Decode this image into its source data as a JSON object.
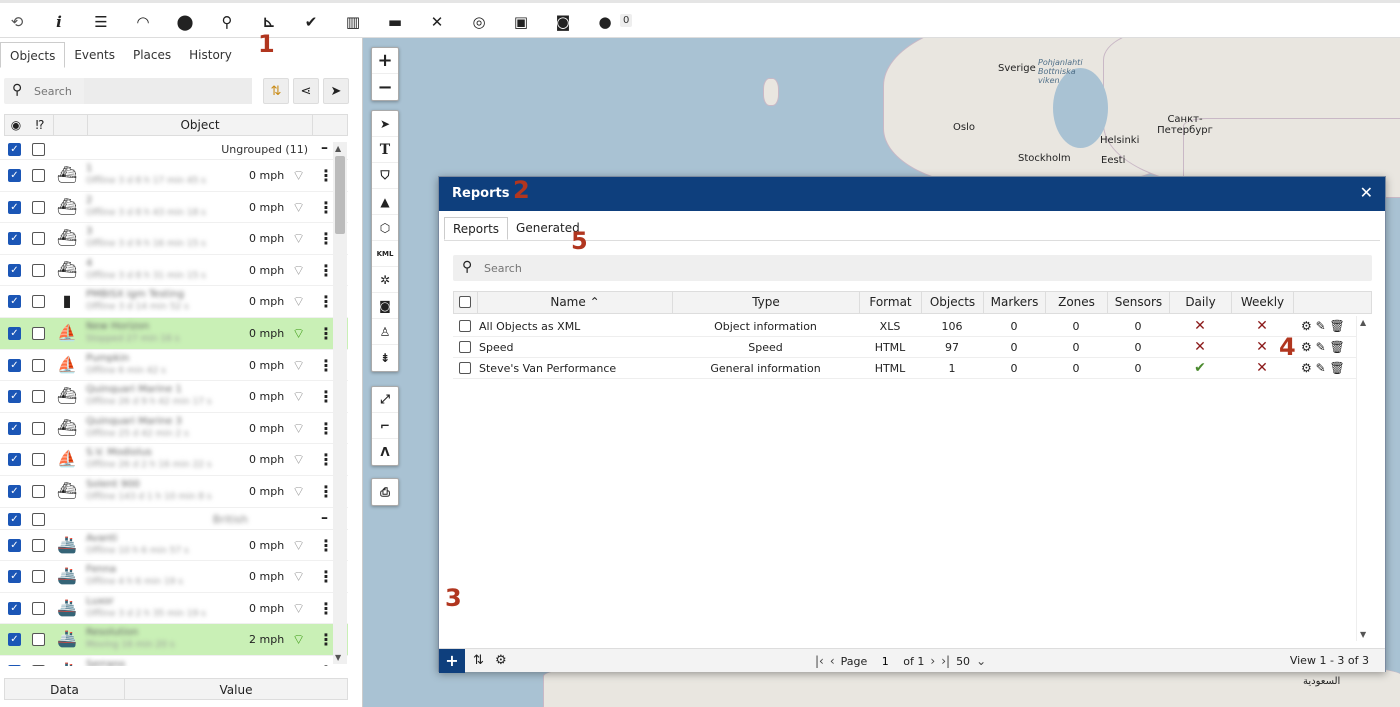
{
  "toolbar": {
    "icons": [
      "logo-icon",
      "info-icon",
      "sliders-icon",
      "speedometer-icon",
      "marker-icon",
      "search-icon",
      "chart-icon",
      "check-icon",
      "book-icon",
      "car-icon",
      "tools-icon",
      "database-icon",
      "code-window-icon",
      "camera-icon",
      "chat-icon"
    ],
    "chat_count": "0"
  },
  "annotations": [
    "1",
    "2",
    "3",
    "4",
    "5"
  ],
  "left": {
    "tabs": [
      "Objects",
      "Events",
      "Places",
      "History"
    ],
    "search_placeholder": "Search",
    "object_col": "Object",
    "group1_label": "Ungrouped (11)",
    "group2_label": "British",
    "minus": "–",
    "data_col": "Data",
    "value_col": "Value",
    "rows": [
      {
        "name": "1",
        "sub": "Offline 3 d 8 h 17 min 45 s",
        "speed": "0 mph",
        "green": false,
        "vehicle": "boat-icon"
      },
      {
        "name": "2",
        "sub": "Offline 3 d 8 h 43 min 18 s",
        "speed": "0 mph",
        "green": false,
        "vehicle": "boat-icon"
      },
      {
        "name": "3",
        "sub": "Offline 3 d 9 h 16 min 15 s",
        "speed": "0 mph",
        "green": false,
        "vehicle": "boat-icon"
      },
      {
        "name": "4",
        "sub": "Offline 3 d 8 h 31 min 15 s",
        "speed": "0 mph",
        "green": false,
        "vehicle": "boat-icon"
      },
      {
        "name": "PMBISX igm Testing",
        "sub": "Offline 3 d 14 min 52 s",
        "speed": "0 mph",
        "green": false,
        "vehicle": "device-icon"
      },
      {
        "name": "New Horizon",
        "sub": "Stopped 27 min 16 s",
        "speed": "0 mph",
        "green": true,
        "vehicle": "rib-icon"
      },
      {
        "name": "Pumpkin",
        "sub": "Offline 6 min 42 s",
        "speed": "0 mph",
        "green": false,
        "vehicle": "rib-icon"
      },
      {
        "name": "Quinquari Marine 1",
        "sub": "Offline 26 d 9 h 42 min 17 s",
        "speed": "0 mph",
        "green": false,
        "vehicle": "boat-icon"
      },
      {
        "name": "Quinquari Marine 3",
        "sub": "Offline 25 d 42 min 2 s",
        "speed": "0 mph",
        "green": false,
        "vehicle": "boat-icon"
      },
      {
        "name": "S.V. Modiolus",
        "sub": "Offline 26 d 2 h 16 min 22 s",
        "speed": "0 mph",
        "green": false,
        "vehicle": "rib-icon"
      },
      {
        "name": "Solent 900",
        "sub": "Offline 143 d 1 h 10 min 8 s",
        "speed": "0 mph",
        "green": false,
        "vehicle": "boat-icon"
      },
      {
        "group": true
      },
      {
        "name": "Avanti",
        "sub": "Offline 10 h 6 min 57 s",
        "speed": "0 mph",
        "green": false,
        "vehicle": "ship-icon"
      },
      {
        "name": "Fenna",
        "sub": "Offline 4 h 6 min 19 s",
        "speed": "0 mph",
        "green": false,
        "vehicle": "ship-icon"
      },
      {
        "name": "Luxor",
        "sub": "Offline 3 d 2 h 35 min 19 s",
        "speed": "0 mph",
        "green": false,
        "vehicle": "ship-icon"
      },
      {
        "name": "Resolution",
        "sub": "Moving 16 min 20 s",
        "speed": "2 mph",
        "green": true,
        "vehicle": "ship-icon"
      },
      {
        "name": "Serrano",
        "sub": "",
        "speed": "",
        "green": false,
        "vehicle": "ship-icon"
      }
    ]
  },
  "map": {
    "labels": [
      "Sverige",
      "Pohjanlahti Bottniska viken",
      "Oslo",
      "Helsinki",
      "Санкт-Петербург",
      "Stockholm",
      "Eesti",
      "السعودية"
    ]
  },
  "reports": {
    "title": "Reports",
    "tabs": [
      "Reports",
      "Generated"
    ],
    "search_placeholder": "Search",
    "columns": [
      "Name",
      "Type",
      "Format",
      "Objects",
      "Markers",
      "Zones",
      "Sensors",
      "Daily",
      "Weekly"
    ],
    "sort_arrow": "⌃",
    "rows": [
      {
        "name": "All Objects as XML",
        "type": "Object information",
        "format": "XLS",
        "objects": "106",
        "markers": "0",
        "zones": "0",
        "sensors": "0",
        "daily": false,
        "weekly": false
      },
      {
        "name": "Speed",
        "type": "Speed",
        "format": "HTML",
        "objects": "97",
        "markers": "0",
        "zones": "0",
        "sensors": "0",
        "daily": false,
        "weekly": false
      },
      {
        "name": "Steve's Van Performance",
        "type": "General information",
        "format": "HTML",
        "objects": "1",
        "markers": "0",
        "zones": "0",
        "sensors": "0",
        "daily": true,
        "weekly": false
      }
    ],
    "pager": {
      "page_label": "Page",
      "page": "1",
      "of": "of 1",
      "per_page": "50"
    },
    "view_info": "View 1 - 3 of 3"
  },
  "colors": {
    "dialog_header": "#0e3f7d",
    "checkbox_blue": "#1b56b6",
    "green_row": "#c9f0b6",
    "annotation": "#b1361f",
    "cross": "#8b1a1a",
    "check": "#4a8a2e"
  }
}
